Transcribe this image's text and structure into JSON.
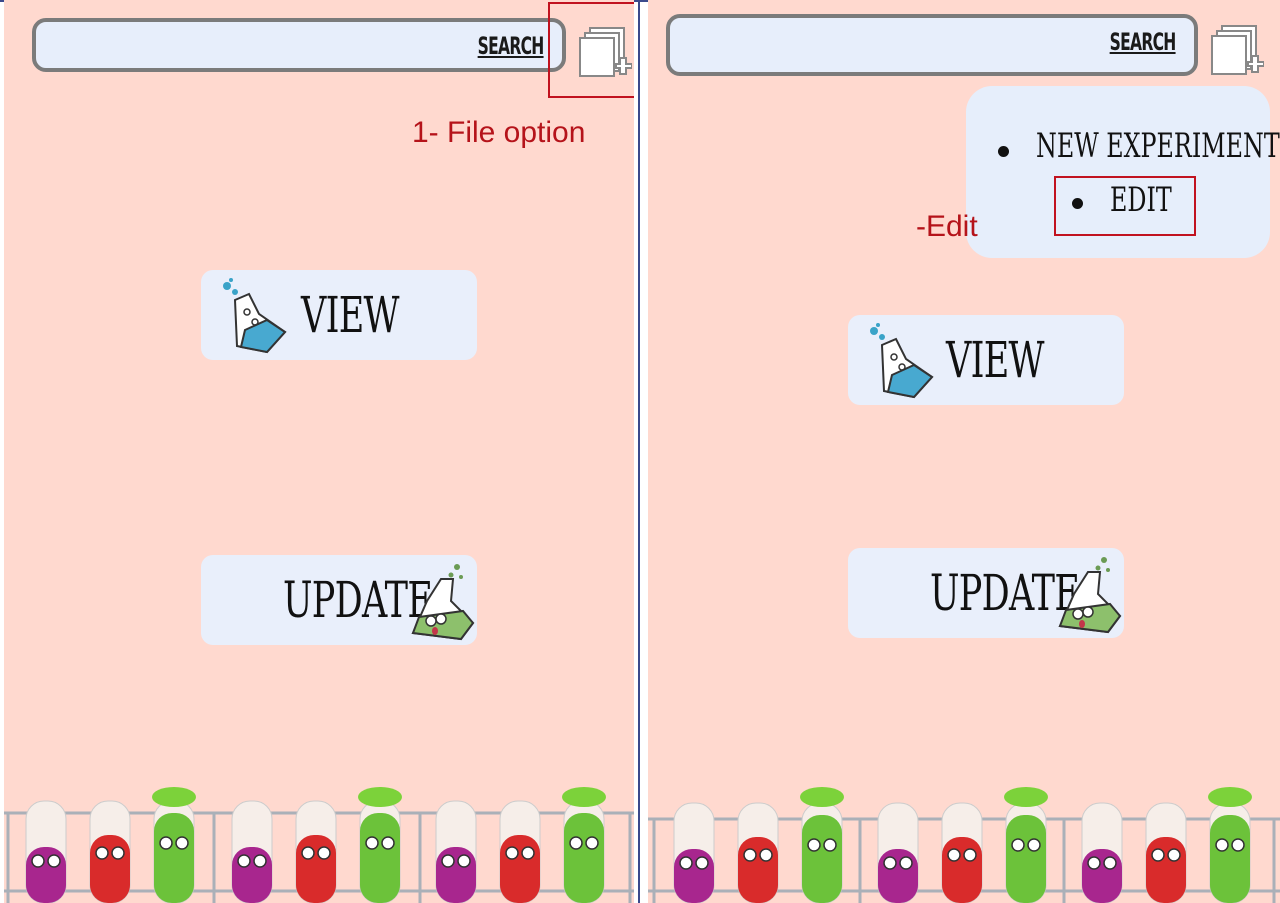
{
  "left": {
    "search_label": "SEARCH",
    "view_label": "VIEW",
    "update_label": "UPDATE",
    "annotation": "1- File option"
  },
  "right": {
    "search_label": "SEARCH",
    "view_label": "VIEW",
    "update_label": "UPDATE",
    "annotation": "-Edit",
    "menu": [
      "NEW EXPERIMENT",
      "EDIT"
    ]
  },
  "colors": {
    "background": "#ffd9cf",
    "card": "#e9effb",
    "annotation": "#b5131a",
    "divider": "#3b4a8c"
  },
  "icons": [
    "file-add-icon",
    "flask-icon",
    "flask-face-icon",
    "test-tubes-illustration"
  ]
}
